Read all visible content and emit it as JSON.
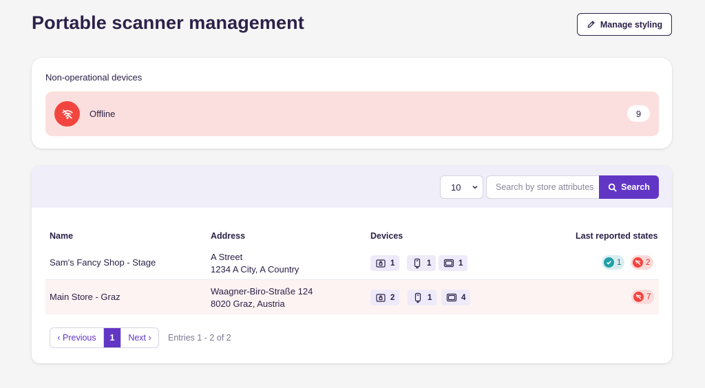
{
  "header": {
    "title": "Portable scanner management",
    "manage_label": "Manage styling"
  },
  "status": {
    "heading": "Non-operational devices",
    "items": [
      {
        "label": "Offline",
        "count": "9",
        "icon": "wifi-off-icon",
        "color": "#f2453f"
      }
    ]
  },
  "toolbar": {
    "page_size": "10",
    "search_placeholder": "Search by store attributes",
    "search_label": "Search"
  },
  "table": {
    "columns": [
      "Name",
      "Address",
      "Devices",
      "Last reported states"
    ],
    "rows": [
      {
        "name": "Sam's Fancy Shop - Stage",
        "address_line1": "A Street",
        "address_line2": "1234 A City, A Country",
        "devices": {
          "locker": "1",
          "scanner": "1",
          "screen": "1"
        },
        "states": {
          "ok": "1",
          "offline": "2"
        }
      },
      {
        "name": "Main Store - Graz",
        "address_line1": "Waagner-Biro-Straße 124",
        "address_line2": "8020 Graz, Austria",
        "devices": {
          "locker": "2",
          "scanner": "1",
          "screen": "4"
        },
        "states": {
          "offline": "7"
        }
      }
    ]
  },
  "pagination": {
    "prev_label": "‹ Previous",
    "current_page": "1",
    "next_label": "Next ›",
    "entries_text": "Entries 1 - 2 of 2"
  },
  "colors": {
    "accent": "#6236c5",
    "title": "#2b2148",
    "danger": "#f2453f",
    "success": "#20a0a8"
  }
}
